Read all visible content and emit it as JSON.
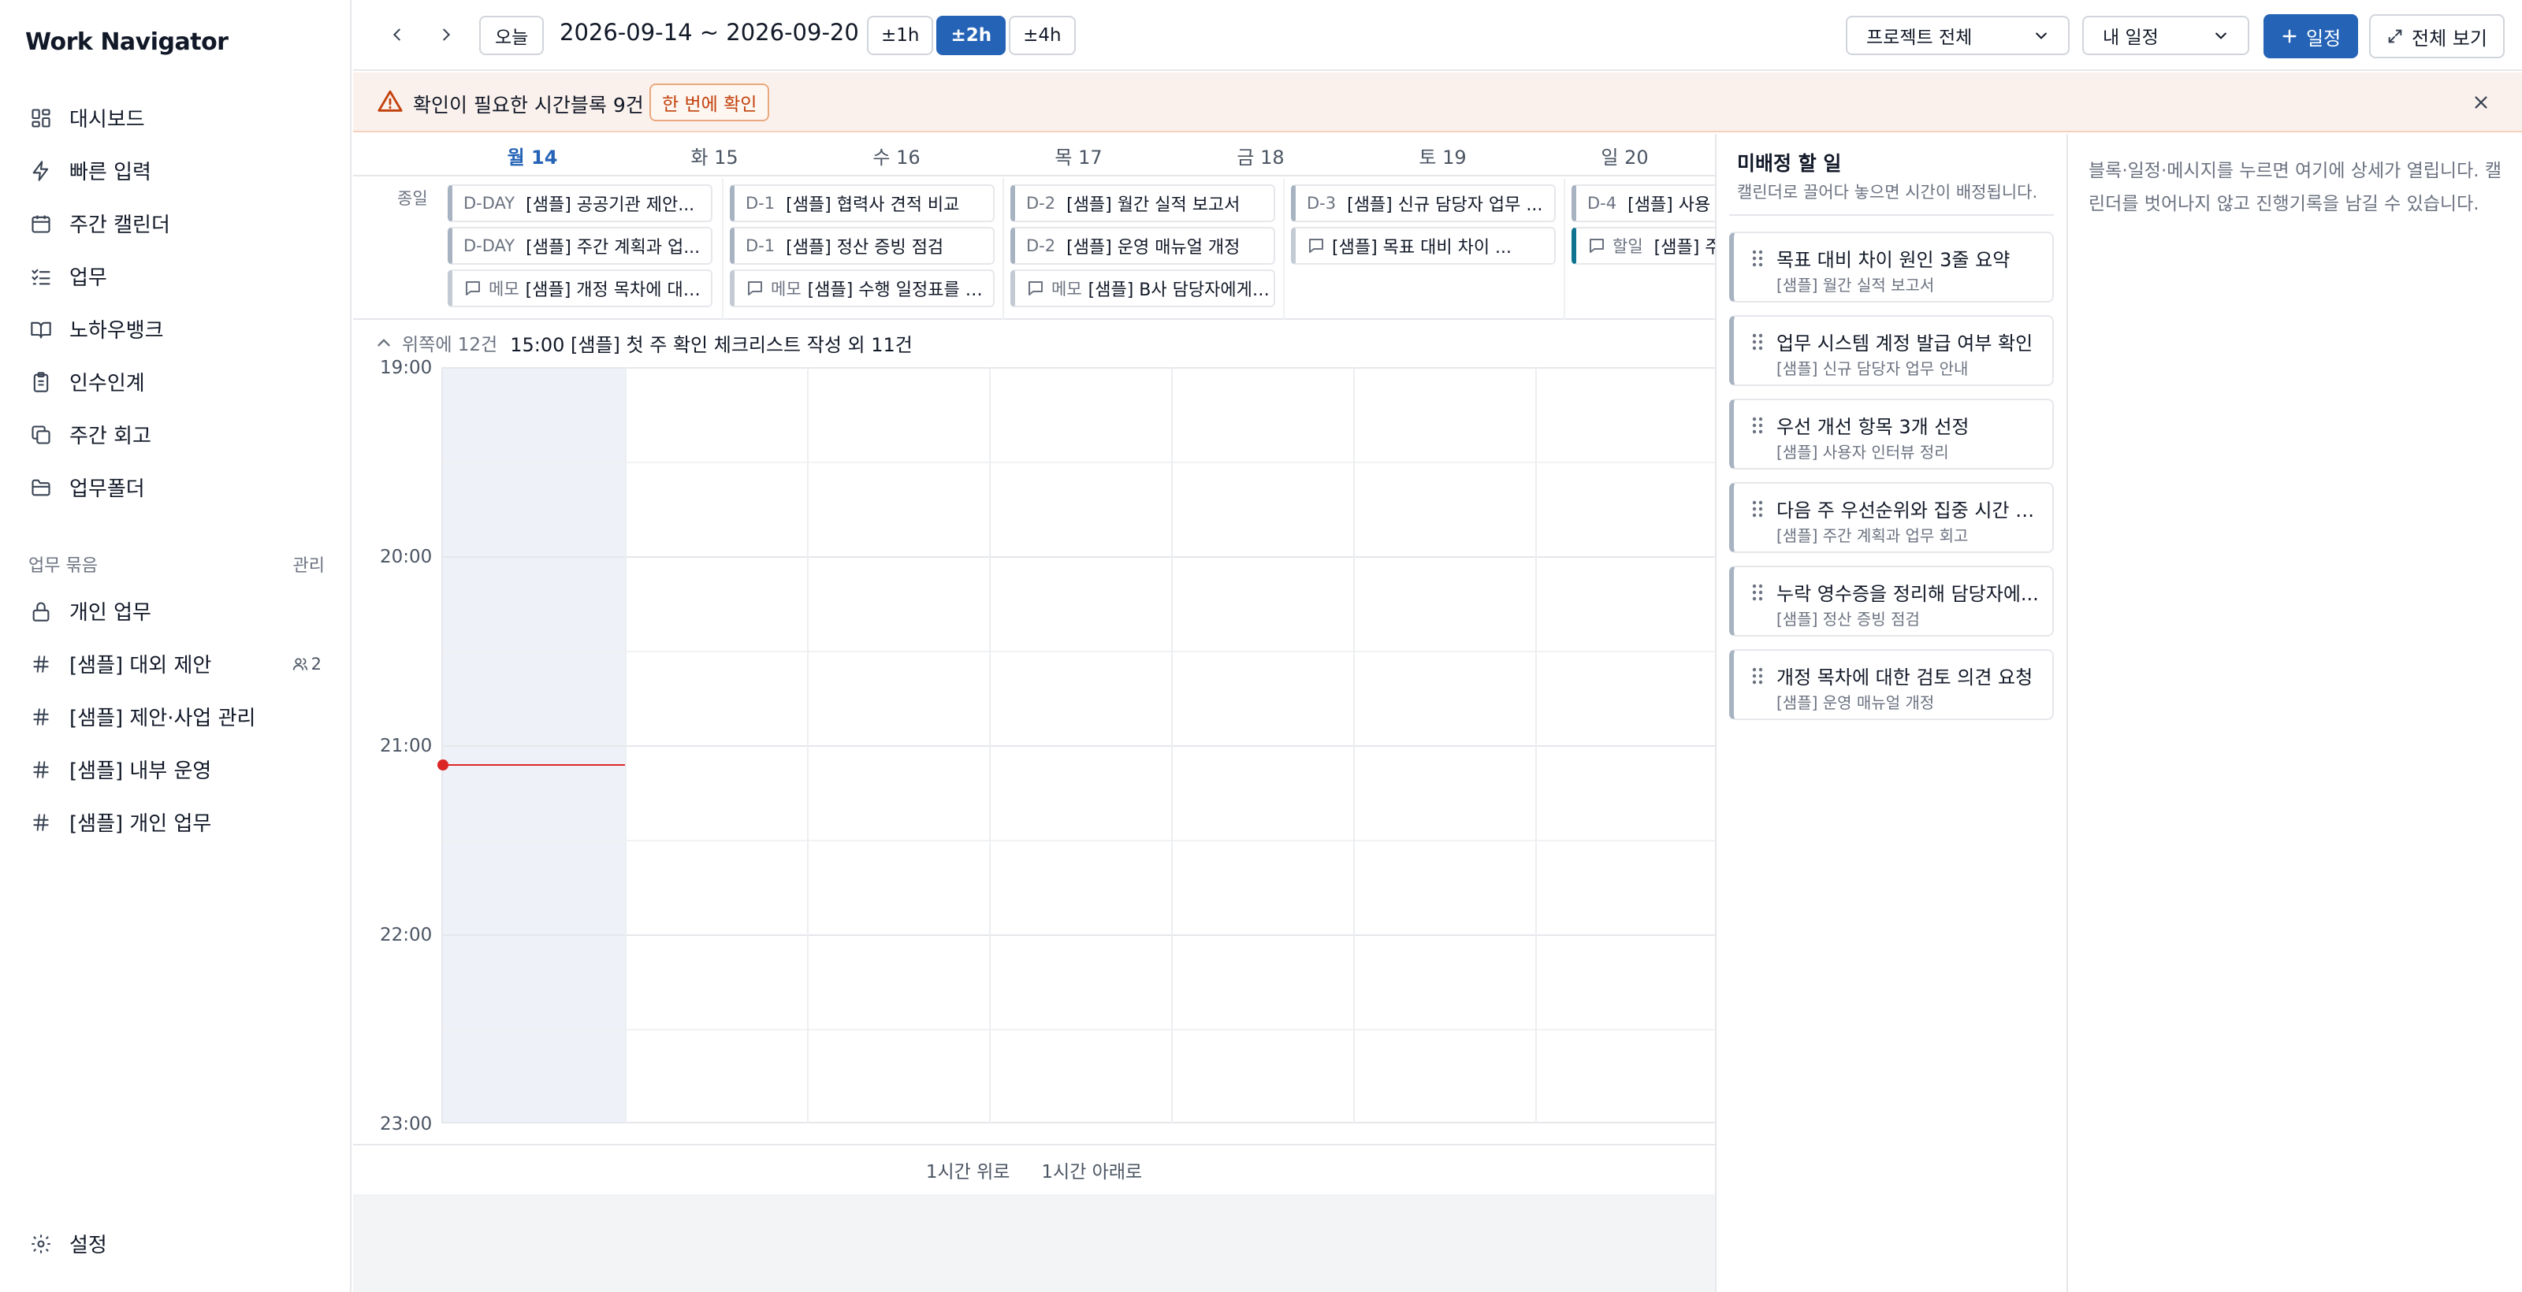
{
  "app": {
    "title": "Work Navigator"
  },
  "sidebar": {
    "nav": [
      {
        "label": "대시보드",
        "icon": "dashboard-icon"
      },
      {
        "label": "빠른 입력",
        "icon": "lightning-icon"
      },
      {
        "label": "주간 캘린더",
        "icon": "calendar-icon"
      },
      {
        "label": "업무",
        "icon": "checklist-icon"
      },
      {
        "label": "노하우뱅크",
        "icon": "book-icon"
      },
      {
        "label": "인수인계",
        "icon": "clipboard-icon"
      },
      {
        "label": "주간 회고",
        "icon": "copy-icon"
      },
      {
        "label": "업무폴더",
        "icon": "folder-icon"
      }
    ],
    "groups_title": "업무 묶음",
    "groups_manage": "관리",
    "groups": [
      {
        "label": "개인 업무",
        "icon": "lock-icon"
      },
      {
        "label": "[샘플] 대외 제안",
        "icon": "hash-icon",
        "members": "2"
      },
      {
        "label": "[샘플] 제안·사업 관리",
        "icon": "hash-icon"
      },
      {
        "label": "[샘플] 내부 운영",
        "icon": "hash-icon"
      },
      {
        "label": "[샘플] 개인 업무",
        "icon": "hash-icon"
      }
    ],
    "settings": "설정"
  },
  "toolbar": {
    "today": "오늘",
    "range": "2026-09-14 ~ 2026-09-20",
    "zoom": [
      "±1h",
      "±2h",
      "±4h"
    ],
    "zoom_active": "±2h",
    "project_select": "프로젝트 전체",
    "schedule_select": "내 일정",
    "add": "일정",
    "full": "전체 보기"
  },
  "alert": {
    "text": "확인이 필요한 시간블록 9건",
    "action": "한 번에 확인"
  },
  "calendar": {
    "days": [
      "월 14",
      "화 15",
      "수 16",
      "목 17",
      "금 18",
      "토 19",
      "일 20"
    ],
    "today_index": 0,
    "allday_label": "종일",
    "allday": [
      [
        {
          "tag": "D-DAY",
          "title": "[샘플] 공공기관 제안..."
        },
        {
          "tag": "D-DAY",
          "title": "[샘플] 주간 계획과 업..."
        },
        {
          "tag": "메모",
          "title": "[샘플] 개정 목차에 대한...",
          "memo": true
        }
      ],
      [
        {
          "tag": "D-1",
          "title": "[샘플] 협력사 견적 비교"
        },
        {
          "tag": "D-1",
          "title": "[샘플] 정산 증빙 점검"
        },
        {
          "tag": "메모",
          "title": "[샘플] 수행 일정표를 정...",
          "memo": true
        }
      ],
      [
        {
          "tag": "D-2",
          "title": "[샘플] 월간 실적 보고서"
        },
        {
          "tag": "D-2",
          "title": "[샘플] 운영 매뉴얼 개정"
        },
        {
          "tag": "메모",
          "title": "[샘플] B사 담당자에게 ...",
          "memo": true
        }
      ],
      [
        {
          "tag": "D-3",
          "title": "[샘플] 신규 담당자 업무 ..."
        },
        {
          "tag": "메모",
          "title": "[샘플] 목표 대비 차이 ...",
          "memo": true
        }
      ],
      [
        {
          "tag": "D-4",
          "title": "[샘플] 사용"
        },
        {
          "tag": "할일",
          "title": "[샘플] 주",
          "todo": true
        }
      ]
    ],
    "above_count": "위쪽에 12건",
    "above_item": "15:00 [샘플] 첫 주 확인 체크리스트 작성 외 11건",
    "hours": [
      "19:00",
      "20:00",
      "21:00",
      "22:00",
      "23:00"
    ],
    "now_time": "21:04",
    "footer_up": "1시간 위로",
    "footer_down": "1시간 아래로"
  },
  "unassigned": {
    "title": "미배정 할 일",
    "subtitle": "캘린더로 끌어다 놓으면 시간이 배정됩니다.",
    "tasks": [
      {
        "title": "목표 대비 차이 원인 3줄 요약",
        "project": "[샘플] 월간 실적 보고서"
      },
      {
        "title": "업무 시스템 계정 발급 여부 확인",
        "project": "[샘플] 신규 담당자 업무 안내"
      },
      {
        "title": "우선 개선 항목 3개 선정",
        "project": "[샘플] 사용자 인터뷰 정리"
      },
      {
        "title": "다음 주 우선순위와 집중 시간 배정",
        "project": "[샘플] 주간 계획과 업무 회고"
      },
      {
        "title": "누락 영수증을 정리해 담당자에...",
        "project": "[샘플] 정산 증빙 점검"
      },
      {
        "title": "개정 목차에 대한 검토 의견 요청",
        "project": "[샘플] 운영 매뉴얼 개정"
      }
    ]
  },
  "detail": {
    "hint": "블록·일정·메시지를 누르면 여기에 상세가 열립니다. 캘린더를 벗어나지 않고 진행기록을 남길 수 있습니다."
  },
  "colors": {
    "accent": "#2563b6",
    "alert_bg": "#fbf1ec",
    "now": "#dc2626"
  }
}
